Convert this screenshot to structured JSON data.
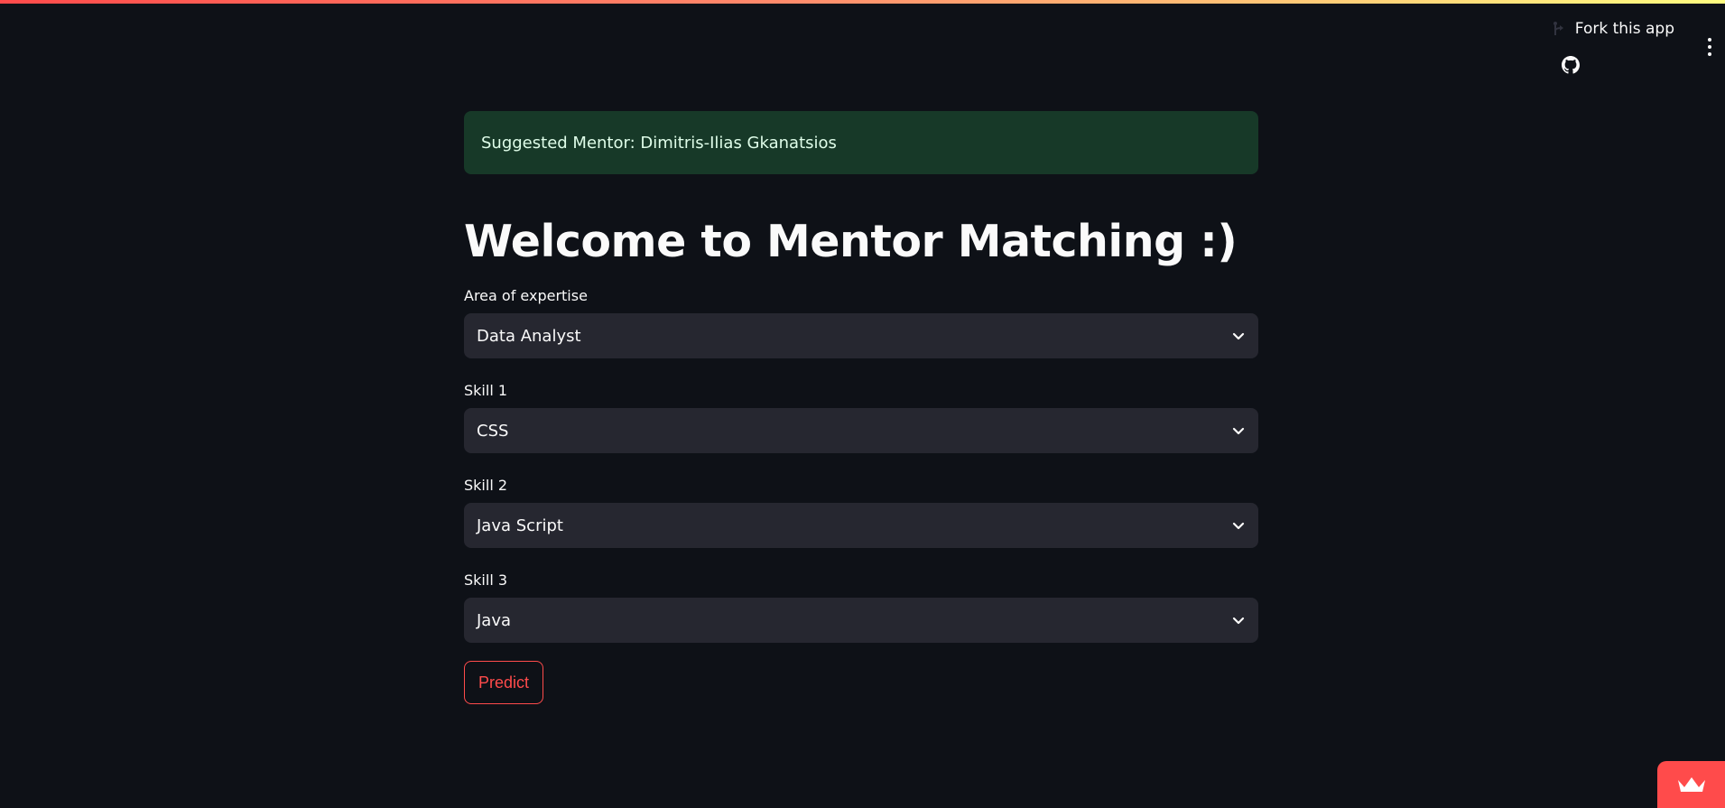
{
  "toolbar": {
    "fork_label": "Fork this app",
    "fork_icon": "fork-icon",
    "github_icon": "github-icon",
    "menu_icon": "kebab-menu-icon"
  },
  "alert": {
    "text": "Suggested Mentor: Dimitris-Ilias Gkanatsios",
    "color": "#173928"
  },
  "page": {
    "title": "Welcome to Mentor Matching :)"
  },
  "form": {
    "fields": [
      {
        "label": "Area of expertise",
        "value": "Data Analyst"
      },
      {
        "label": "Skill 1",
        "value": "CSS"
      },
      {
        "label": "Skill 2",
        "value": "Java Script"
      },
      {
        "label": "Skill 3",
        "value": "Java"
      }
    ],
    "submit_label": "Predict"
  },
  "colors": {
    "background": "#0e1117",
    "select_bg": "#262730",
    "accent": "#ff4b4b"
  },
  "badge": {
    "icon": "streamlit-crown-icon"
  }
}
